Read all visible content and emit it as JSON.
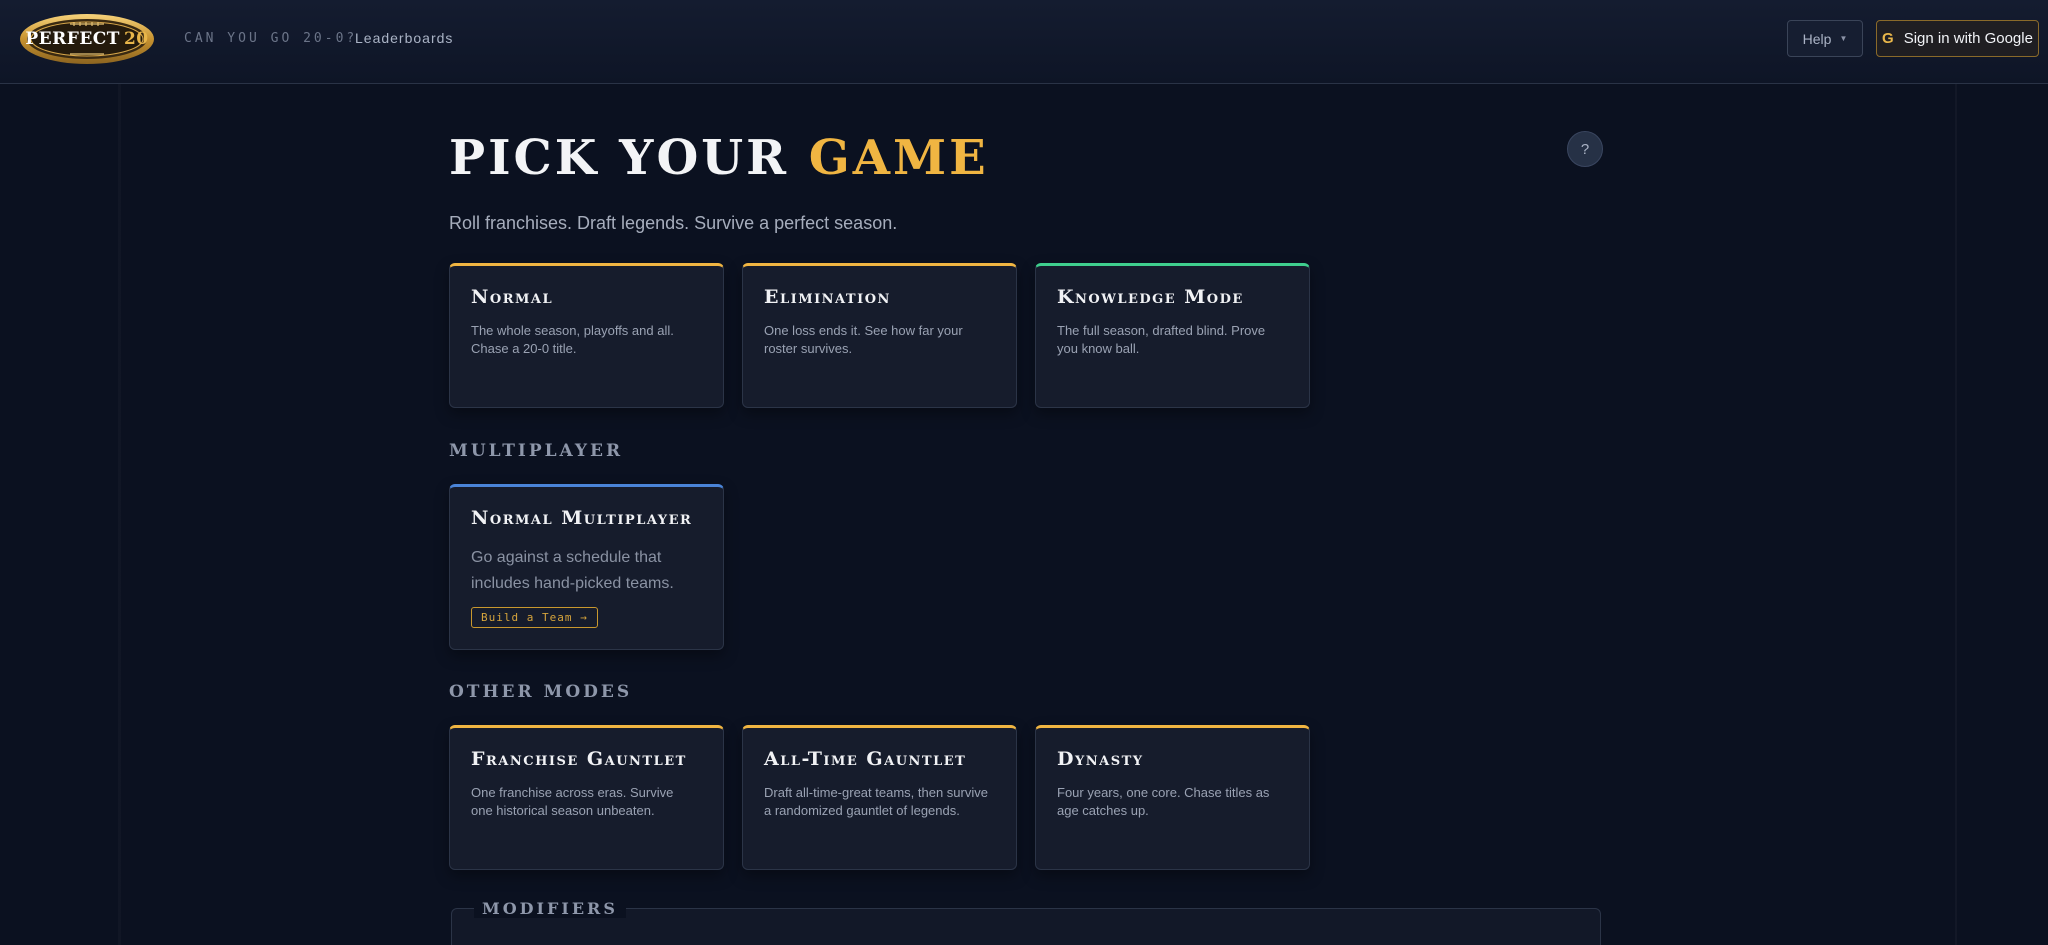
{
  "header": {
    "logo": {
      "text_main": "PERFECT",
      "text_number": "20"
    },
    "tagline": "CAN YOU GO 20-0?",
    "nav": {
      "leaderboards": "Leaderboards"
    },
    "help_label": "Help",
    "signin": {
      "g_glyph": "G",
      "label": "Sign in with Google"
    }
  },
  "main": {
    "title_prefix": "PICK YOUR",
    "title_accent": "GAME",
    "help_glyph": "?",
    "subtitle": "Roll franchises. Draft legends. Survive a perfect season.",
    "primary_modes": [
      {
        "title": "Normal",
        "desc": "The whole season, playoffs and all. Chase a 20-0 title."
      },
      {
        "title": "Elimination",
        "desc": "One loss ends it. See how far your roster survives."
      },
      {
        "title": "Knowledge Mode",
        "desc": "The full season, drafted blind. Prove you know ball."
      }
    ],
    "multiplayer": {
      "label": "MULTIPLAYER",
      "card": {
        "title": "Normal Multiplayer",
        "desc": "Go against a schedule that includes hand-picked teams.",
        "button": "Build a Team →"
      }
    },
    "other_modes": {
      "label": "OTHER MODES",
      "cards": [
        {
          "title": "Franchise Gauntlet",
          "desc": "One franchise across eras. Survive one historical season unbeaten."
        },
        {
          "title": "All-Time Gauntlet",
          "desc": "Draft all-time-great teams, then survive a randomized gauntlet of legends."
        },
        {
          "title": "Dynasty",
          "desc": "Four years, one core. Chase titles as age catches up."
        }
      ]
    },
    "modifiers_label": "MODIFIERS"
  },
  "colors": {
    "gold": "#f0b542",
    "green": "#3fcf8e",
    "blue": "#4a84d8",
    "background": "#0b1120"
  }
}
